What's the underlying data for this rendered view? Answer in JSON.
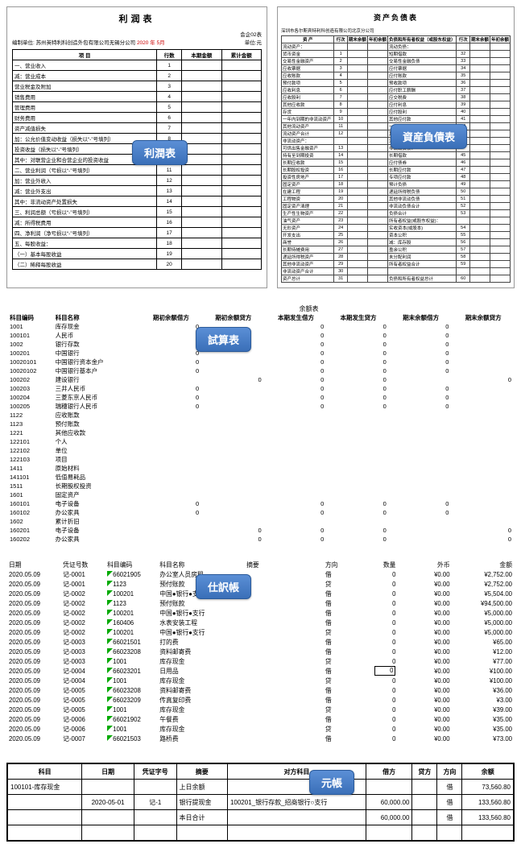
{
  "profit": {
    "title": "利润表",
    "formCode": "会企02表",
    "orgLabel": "编制单位:",
    "org": "苏州英特利科创造外包有限公司无锡分公司",
    "period": "2020 年  5月",
    "unit": "单位:元",
    "cols": [
      "项    目",
      "行数",
      "本期金额",
      "累计金额"
    ],
    "rows": [
      [
        "一、营业收入",
        "1"
      ],
      [
        "减：营业成本",
        "2"
      ],
      [
        "    营业税金及附加",
        "3"
      ],
      [
        "    销售费用",
        "4"
      ],
      [
        "    管理费用",
        "5"
      ],
      [
        "    财务费用",
        "6"
      ],
      [
        "    资产减值损失",
        "7"
      ],
      [
        "加：公允价值变动收益（损失以“-”号填列）",
        "8"
      ],
      [
        "    投资收益（损失以“-”号填列）",
        "9"
      ],
      [
        "    其中：对联营企业和合营企业的投资收益",
        "10"
      ],
      [
        "二、营业利润（亏损以“-”号填列）",
        "11"
      ],
      [
        "加：营业外收入",
        "12"
      ],
      [
        "减：营业外支出",
        "13"
      ],
      [
        "    其中：非流动资产处置损失",
        "14"
      ],
      [
        "三、利润总额（亏损以“-”号填列）",
        "15"
      ],
      [
        "减：所得税费用",
        "16"
      ],
      [
        "四、净利润（净亏损以“-”号填列）",
        "17"
      ],
      [
        "五、每股收益：",
        "18"
      ],
      [
        "（一）基本每股收益",
        "19"
      ],
      [
        "（二）稀释每股收益",
        "20"
      ]
    ],
    "badge": "利潤表"
  },
  "balance": {
    "title": "资产负债表",
    "org": "深圳市各尔斯宾特利科创造有限公司北京分公司",
    "cols": [
      "资   产",
      "行次",
      "期末余额",
      "年初余额",
      "负债和所有者权益（或股东权益）",
      "行次",
      "期末余额",
      "年初余额"
    ],
    "rows": [
      [
        "流动资产：",
        "",
        "",
        "",
        "流动负债：",
        "",
        "",
        ""
      ],
      [
        "  货币资金",
        "1",
        "",
        "",
        "  短期借款",
        "32",
        "",
        ""
      ],
      [
        "  交易性金融资产",
        "2",
        "",
        "",
        "  交易性金融负债",
        "33",
        "",
        ""
      ],
      [
        "  应收票据",
        "3",
        "",
        "",
        "  应付票据",
        "34",
        "",
        ""
      ],
      [
        "  应收账款",
        "4",
        "",
        "",
        "  应付账款",
        "35",
        "",
        ""
      ],
      [
        "  预付款项",
        "5",
        "",
        "",
        "  预收款项",
        "36",
        "",
        ""
      ],
      [
        "  应收利息",
        "6",
        "",
        "",
        "  应付职工薪酬",
        "37",
        "",
        ""
      ],
      [
        "  应收股利",
        "7",
        "",
        "",
        "  应交税费",
        "38",
        "",
        ""
      ],
      [
        "  其他应收款",
        "8",
        "",
        "",
        "  应付利息",
        "39",
        "",
        ""
      ],
      [
        "  存货",
        "9",
        "",
        "",
        "  应付股利",
        "40",
        "",
        ""
      ],
      [
        "  一年内到期的非流动资产",
        "10",
        "",
        "",
        "  其他应付款",
        "41",
        "",
        ""
      ],
      [
        "  其他流动资产",
        "11",
        "",
        "",
        "  一年内到期的非流动负债",
        "42",
        "",
        ""
      ],
      [
        "流动资产合计",
        "12",
        "",
        "",
        "  其他流动负债",
        "43",
        "",
        ""
      ],
      [
        "非流动资产：",
        "",
        "",
        "",
        "流动负债合计",
        "44",
        "",
        ""
      ],
      [
        "  可供出售金融资产",
        "13",
        "",
        "",
        "非流动负债：",
        "",
        "",
        ""
      ],
      [
        "  持有至到期投资",
        "14",
        "",
        "",
        "  长期借款",
        "45",
        "",
        ""
      ],
      [
        "  长期应收款",
        "15",
        "",
        "",
        "  应付债券",
        "46",
        "",
        ""
      ],
      [
        "  长期股权投资",
        "16",
        "",
        "",
        "  长期应付款",
        "47",
        "",
        ""
      ],
      [
        "  投资性房地产",
        "17",
        "",
        "",
        "  专项应付款",
        "48",
        "",
        ""
      ],
      [
        "  固定资产",
        "18",
        "",
        "",
        "  预计负债",
        "49",
        "",
        ""
      ],
      [
        "  在建工程",
        "19",
        "",
        "",
        "  递延所得税负债",
        "50",
        "",
        ""
      ],
      [
        "  工程物资",
        "20",
        "",
        "",
        "  其他非流动负债",
        "51",
        "",
        ""
      ],
      [
        "  固定资产清理",
        "21",
        "",
        "",
        "非流动负债合计",
        "52",
        "",
        ""
      ],
      [
        "  生产性生物资产",
        "22",
        "",
        "",
        "负债合计",
        "53",
        "",
        ""
      ],
      [
        "  油气资产",
        "23",
        "",
        "",
        "所有者权益(或股东权益)：",
        "",
        "",
        ""
      ],
      [
        "  无形资产",
        "24",
        "",
        "",
        "  实收资本(或股本)",
        "54",
        "",
        ""
      ],
      [
        "  开发支出",
        "25",
        "",
        "",
        "  资本公积",
        "55",
        "",
        ""
      ],
      [
        "  商誉",
        "26",
        "",
        "",
        "  减：库存股",
        "56",
        "",
        ""
      ],
      [
        "  长期待摊费用",
        "27",
        "",
        "",
        "  盈余公积",
        "57",
        "",
        ""
      ],
      [
        "  递延所得税资产",
        "28",
        "",
        "",
        "  未分配利润",
        "58",
        "",
        ""
      ],
      [
        "  其他非流动资产",
        "29",
        "",
        "",
        "所有者权益合计",
        "59",
        "",
        ""
      ],
      [
        "非流动资产合计",
        "30",
        "",
        "",
        "",
        "",
        "",
        ""
      ],
      [
        "资产总计",
        "31",
        "",
        "",
        "负债和所有者权益总计",
        "60",
        "",
        ""
      ]
    ],
    "badge": "資産負債表"
  },
  "trial": {
    "title": "余额表",
    "cols": [
      "科目编码",
      "科目名称",
      "期初余额借方",
      "期初余额贷方",
      "本期发生借方",
      "本期发生贷方",
      "期末余额借方",
      "期末余额贷方"
    ],
    "rows": [
      [
        "1001",
        "库存现金",
        "0",
        "",
        "0",
        "0",
        "0",
        ""
      ],
      [
        "100101",
        "    人民币",
        "0",
        "",
        "0",
        "0",
        "0",
        ""
      ],
      [
        "1002",
        "银行存款",
        "0",
        "",
        "0",
        "0",
        "0",
        ""
      ],
      [
        "100201",
        "    中国银行",
        "0",
        "",
        "0",
        "0",
        "0",
        ""
      ],
      [
        "10020101",
        "        中国银行资本金户",
        "0",
        "",
        "0",
        "0",
        "0",
        ""
      ],
      [
        "10020102",
        "        中国银行基本户",
        "0",
        "",
        "0",
        "0",
        "0",
        ""
      ],
      [
        "100202",
        "    建设银行",
        "",
        "0",
        "0",
        "0",
        "",
        "0"
      ],
      [
        "100203",
        "    三井人民币",
        "0",
        "",
        "0",
        "0",
        "0",
        ""
      ],
      [
        "100204",
        "    三菱东京人民币",
        "0",
        "",
        "0",
        "0",
        "0",
        ""
      ],
      [
        "100205",
        "    瑞穗银行人民币",
        "0",
        "",
        "0",
        "0",
        "0",
        ""
      ],
      [
        "1122",
        "应收账款",
        "",
        "",
        "",
        "",
        "",
        ""
      ],
      [
        "1123",
        "预付账款",
        "",
        "",
        "",
        "",
        "",
        ""
      ],
      [
        "1221",
        "其他应收款",
        "",
        "",
        "",
        "",
        "",
        ""
      ],
      [
        "122101",
        "    个人",
        "",
        "",
        "",
        "",
        "",
        ""
      ],
      [
        "122102",
        "    单位",
        "",
        "",
        "",
        "",
        "",
        ""
      ],
      [
        "122103",
        "    项目",
        "",
        "",
        "",
        "",
        "",
        ""
      ],
      [
        "1411",
        "原始材料",
        "",
        "",
        "",
        "",
        "",
        ""
      ],
      [
        "141101",
        "    低值易耗品",
        "",
        "",
        "",
        "",
        "",
        ""
      ],
      [
        "1511",
        "长期股权投资",
        "",
        "",
        "",
        "",
        "",
        ""
      ],
      [
        "1601",
        "固定资产",
        "",
        "",
        "",
        "",
        "",
        ""
      ],
      [
        "160101",
        "    电子设备",
        "0",
        "",
        "0",
        "0",
        "0",
        ""
      ],
      [
        "160102",
        "    办公家具",
        "0",
        "",
        "0",
        "0",
        "0",
        ""
      ],
      [
        "1602",
        "累计折旧",
        "",
        "",
        "",
        "",
        "",
        ""
      ],
      [
        "160201",
        "    电子设备",
        "",
        "0",
        "0",
        "0",
        "",
        "0"
      ],
      [
        "160202",
        "    办公家具",
        "",
        "0",
        "0",
        "0",
        "",
        "0"
      ]
    ],
    "badge": "試算表"
  },
  "journal": {
    "cols": [
      "日期",
      "凭证号数",
      "科目编码",
      "科目名称",
      "摘要",
      "方向",
      "数量",
      "外币",
      "金额"
    ],
    "rows": [
      [
        "2020.05.09",
        "记-0001",
        "66021905",
        "办公室人员房租",
        "",
        "借",
        "0",
        "¥0.00",
        "¥2,752.00"
      ],
      [
        "2020.05.09",
        "记-0001",
        "1123",
        "预付账款",
        "",
        "贷",
        "0",
        "¥0.00",
        "¥2,752.00"
      ],
      [
        "2020.05.09",
        "记-0002",
        "100201",
        "中国●银行●支行",
        "",
        "借",
        "0",
        "¥0.00",
        "¥5,504.00"
      ],
      [
        "2020.05.09",
        "记-0002",
        "1123",
        "预付账款",
        "",
        "借",
        "0",
        "¥0.00",
        "¥94,500.00"
      ],
      [
        "2020.05.09",
        "记-0002",
        "100201",
        "中国●银行●支行",
        "",
        "借",
        "0",
        "¥0.00",
        "¥5,000.00"
      ],
      [
        "2020.05.09",
        "记-0002",
        "160406",
        "水表安装工程",
        "",
        "借",
        "0",
        "¥0.00",
        "¥5,000.00"
      ],
      [
        "2020.05.09",
        "记-0002",
        "100201",
        "中国●银行●支行",
        "",
        "贷",
        "0",
        "¥0.00",
        "¥5,000.00"
      ],
      [
        "2020.05.09",
        "记-0003",
        "66021501",
        "打的费",
        "",
        "借",
        "0",
        "¥0.00",
        "¥65.00"
      ],
      [
        "2020.05.09",
        "记-0003",
        "66023208",
        "资料邮寄费",
        "",
        "借",
        "0",
        "¥0.00",
        "¥12.00"
      ],
      [
        "2020.05.09",
        "记-0003",
        "1001",
        "库存现金",
        "",
        "贷",
        "0",
        "¥0.00",
        "¥77.00"
      ],
      [
        "2020.05.09",
        "记-0004",
        "66023201",
        "日用品",
        "",
        "借",
        "0_",
        "¥0.00",
        "¥100.00"
      ],
      [
        "2020.05.09",
        "记-0004",
        "1001",
        "库存现金",
        "",
        "贷",
        "0",
        "¥0.00",
        "¥100.00"
      ],
      [
        "2020.05.09",
        "记-0005",
        "66023208",
        "资料邮寄费",
        "",
        "借",
        "0",
        "¥0.00",
        "¥36.00"
      ],
      [
        "2020.05.09",
        "记-0005",
        "66023209",
        "传真复印费",
        "",
        "借",
        "0",
        "¥0.00",
        "¥3.00"
      ],
      [
        "2020.05.09",
        "记-0005",
        "1001",
        "库存现金",
        "",
        "贷",
        "0",
        "¥0.00",
        "¥39.00"
      ],
      [
        "2020.05.09",
        "记-0006",
        "66021902",
        "午餐费",
        "",
        "借",
        "0",
        "¥0.00",
        "¥35.00"
      ],
      [
        "2020.05.09",
        "记-0006",
        "1001",
        "库存现金",
        "",
        "贷",
        "0",
        "¥0.00",
        "¥35.00"
      ],
      [
        "2020.05.09",
        "记-0007",
        "66021503",
        "路桥费",
        "",
        "借",
        "0",
        "¥0.00",
        "¥73.00"
      ]
    ],
    "badge": "仕訳帳"
  },
  "ledger": {
    "cols": [
      "科目",
      "日期",
      "凭证字号",
      "摘要",
      "对方科目",
      "借方",
      "贷方",
      "方向",
      "余额"
    ],
    "rows": [
      [
        "100101-库存现金",
        "",
        "",
        "上日余额",
        "",
        "",
        "",
        "借",
        "73,560.80"
      ],
      [
        "",
        "2020-05-01",
        "记-1",
        "银行提现金",
        "100201_银行存款_招商银行○支行",
        "60,000.00",
        "",
        "借",
        "133,560.80"
      ],
      [
        "",
        "",
        "",
        "本日合计",
        "",
        "60,000.00",
        "",
        "借",
        "133,560.80"
      ]
    ],
    "badge": "元帳"
  }
}
